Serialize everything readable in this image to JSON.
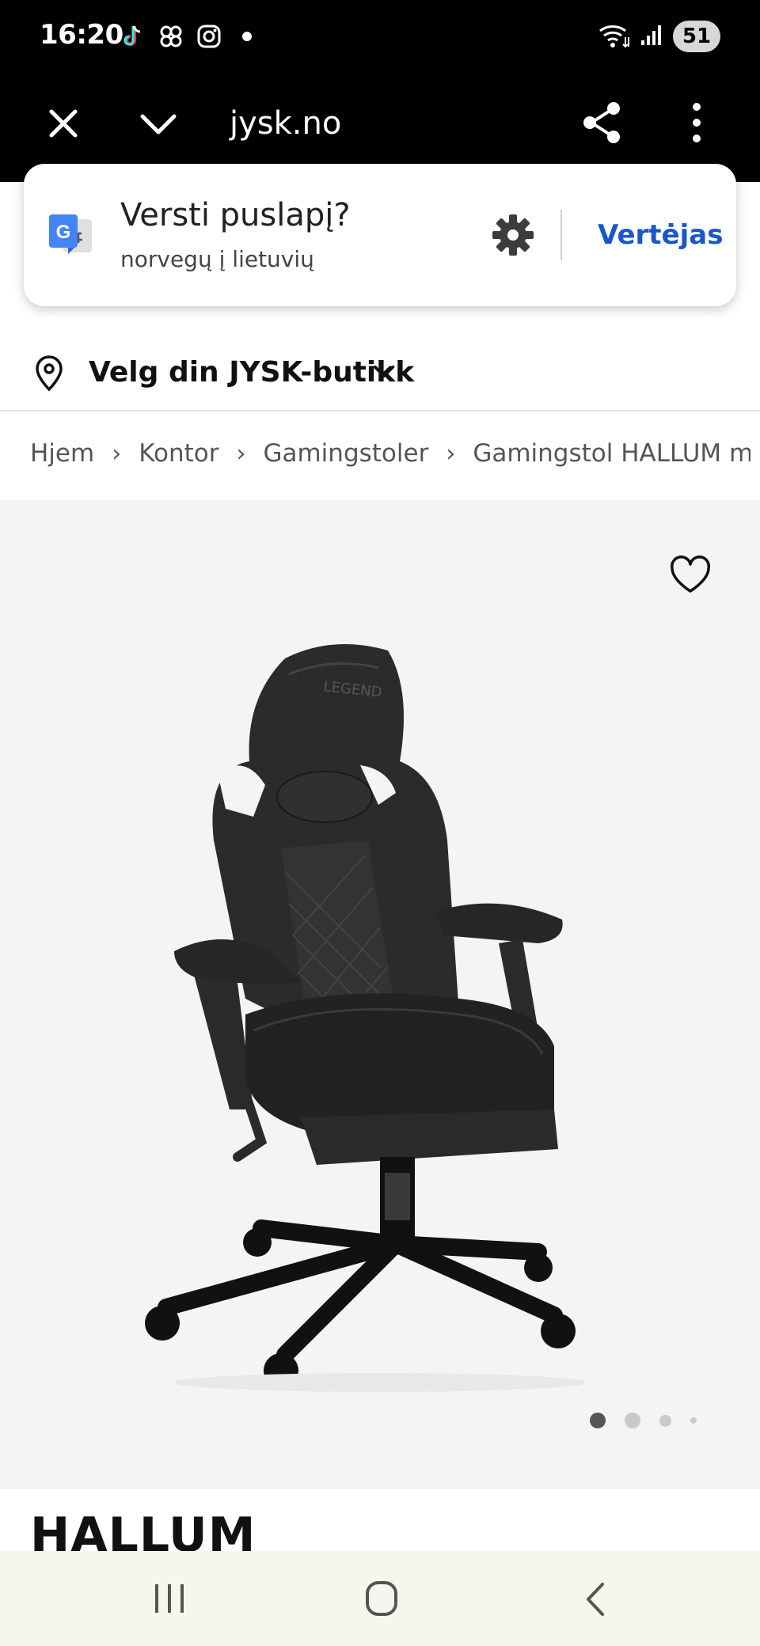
{
  "status_bar": {
    "time": "16:20",
    "battery": "51",
    "app_icons": [
      "tiktok-icon",
      "pinwheel-icon",
      "instagram-icon",
      "dot-icon"
    ],
    "system_icons": [
      "wifi-icon",
      "signal-icon",
      "battery-icon"
    ]
  },
  "browser": {
    "url": "jysk.no"
  },
  "translate": {
    "title": "Versti puslapį?",
    "subtitle": "norvegų į lietuvių",
    "button": "Vertėjas"
  },
  "store": {
    "label": "Velg din JYSK-butikk"
  },
  "breadcrumb": {
    "items": [
      "Hjem",
      "Kontor",
      "Gamingstoler",
      "Gamingstol HALLUM m/fo"
    ]
  },
  "gallery": {
    "image_count": 4,
    "active_index": 0,
    "chair_logo": "LEGEND"
  },
  "product": {
    "title": "HALLUM"
  },
  "colors": {
    "accent_blue": "#1a57c8",
    "bar_black": "#000000",
    "gallery_bg": "#f4f4f4",
    "nav_bg": "#f6f7ec"
  }
}
